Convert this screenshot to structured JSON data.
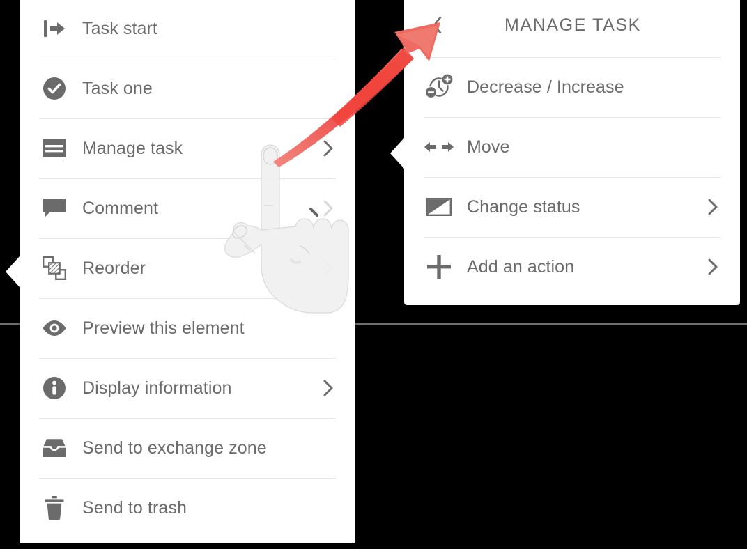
{
  "colors": {
    "panel_bg": "#ffffff",
    "canvas_bg": "#000000",
    "text": "#6b6b6b",
    "divider": "#e6e6e6",
    "accent_arrow": "#ef5350",
    "accent_arrow_bright": "#f44336"
  },
  "left_menu": {
    "items": [
      {
        "label": "Task start",
        "icon": "task-start-icon",
        "chevron": false
      },
      {
        "label": "Task one",
        "icon": "check-circle-icon",
        "chevron": false
      },
      {
        "label": "Manage task",
        "icon": "manage-task-icon",
        "chevron": true
      },
      {
        "label": "Comment",
        "icon": "comment-icon",
        "chevron": true
      },
      {
        "label": "Reorder",
        "icon": "reorder-icon",
        "chevron": true
      },
      {
        "label": "Preview this element",
        "icon": "eye-icon",
        "chevron": false
      },
      {
        "label": "Display information",
        "icon": "info-icon",
        "chevron": true
      },
      {
        "label": "Send to exchange zone",
        "icon": "inbox-icon",
        "chevron": false
      },
      {
        "label": "Send to trash",
        "icon": "trash-icon",
        "chevron": false
      }
    ]
  },
  "right_menu": {
    "title": "MANAGE TASK",
    "back_icon": "chevron-left-icon",
    "items": [
      {
        "label": "Decrease / Increase",
        "icon": "clock-minus-plus-icon",
        "chevron": false
      },
      {
        "label": "Move",
        "icon": "move-arrows-icon",
        "chevron": false
      },
      {
        "label": "Change status",
        "icon": "status-flag-icon",
        "chevron": true
      },
      {
        "label": "Add an action",
        "icon": "plus-icon",
        "chevron": true
      }
    ]
  },
  "annotation": {
    "pointer_hand": "hand-pointing-illustration",
    "arrow": "red-curved-arrow",
    "arrow_from": "Manage task row",
    "arrow_to": "MANAGE TASK back chevron"
  }
}
